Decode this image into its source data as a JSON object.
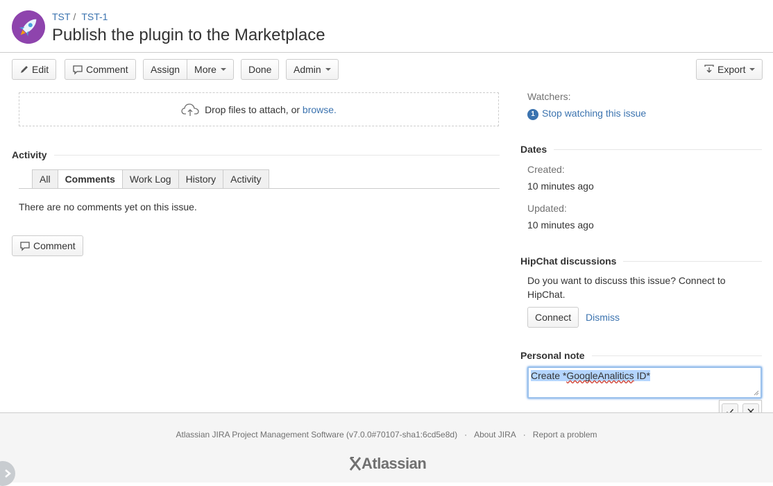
{
  "breadcrumb": {
    "project": "TST",
    "issue_key": "TST-1",
    "separator": "/"
  },
  "issue": {
    "title": "Publish the plugin to the Marketplace"
  },
  "toolbar": {
    "edit": "Edit",
    "comment": "Comment",
    "assign": "Assign",
    "more": "More",
    "done": "Done",
    "admin": "Admin",
    "export": "Export"
  },
  "attachments": {
    "drop_text": "Drop files to attach, or ",
    "browse_link": "browse."
  },
  "activity": {
    "heading": "Activity",
    "tabs": [
      {
        "label": "All",
        "active": false
      },
      {
        "label": "Comments",
        "active": true
      },
      {
        "label": "Work Log",
        "active": false
      },
      {
        "label": "History",
        "active": false
      },
      {
        "label": "Activity",
        "active": false
      }
    ],
    "empty_message": "There are no comments yet on this issue.",
    "comment_button": "Comment"
  },
  "people": {
    "watchers_label": "Watchers:",
    "watchers_count": "1",
    "watch_link": "Stop watching this issue"
  },
  "dates": {
    "heading": "Dates",
    "created_label": "Created:",
    "created_value": "10 minutes ago",
    "updated_label": "Updated:",
    "updated_value": "10 minutes ago"
  },
  "hipchat": {
    "heading": "HipChat discussions",
    "message": "Do you want to discuss this issue? Connect to HipChat.",
    "connect_button": "Connect",
    "dismiss_link": "Dismiss"
  },
  "personal_note": {
    "heading": "Personal note",
    "text_prefix": "Create *",
    "text_misspelled": "GoogleAnalitics",
    "text_suffix": " ID*"
  },
  "footer": {
    "version_text": "Atlassian JIRA Project Management Software (v7.0.0#70107-sha1:6cd5e8d)",
    "about_link": "About JIRA",
    "report_link": "Report a problem",
    "separator": "·",
    "logo_text": "Atlassian"
  },
  "colors": {
    "link": "#3b73af",
    "avatar": "#8e44ad",
    "note_highlight": "#b4d5fe",
    "footer_bg": "#f5f5f5"
  },
  "icons": {
    "avatar": "rocket-icon",
    "edit": "pencil-icon",
    "comment": "speech-bubble-icon",
    "export": "download-icon",
    "upload": "cloud-upload-icon",
    "confirm": "check-icon",
    "cancel": "close-icon"
  }
}
